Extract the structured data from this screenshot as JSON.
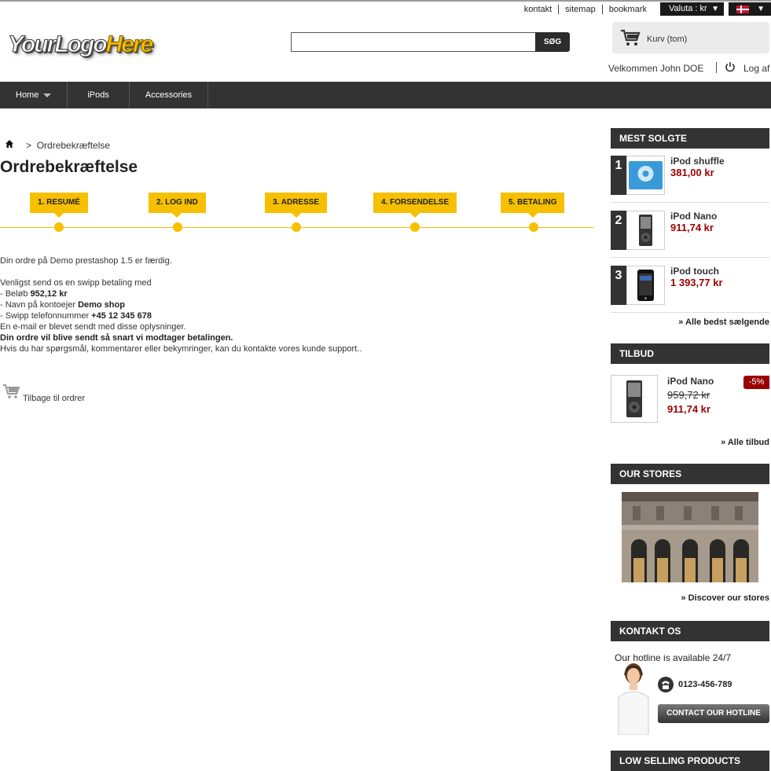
{
  "header": {
    "top_links": [
      "kontakt",
      "sitemap",
      "bookmark"
    ],
    "currency_label": "Valuta : kr",
    "currency_arrow": "▼",
    "language_arrow": "▼",
    "logo_part1": "YourLogo",
    "logo_part2": "Here",
    "search_placeholder": "",
    "search_button": "SØG",
    "cart_label": "Kurv (tom)",
    "welcome": "Velkommen John DOE",
    "logout": "Log af"
  },
  "nav": {
    "items": [
      "Home",
      "iPods",
      "Accessories"
    ]
  },
  "breadcrumb": {
    "separator": ">",
    "current": "Ordrebekræftelse"
  },
  "page": {
    "title": "Ordrebekræftelse",
    "steps": [
      "1. RESUMÉ",
      "2. LOG IND",
      "3. ADRESSE",
      "4. FORSENDELSE",
      "5. BETALING"
    ],
    "confirmation": {
      "line1": "Din ordre på Demo prestashop 1.5 er færdig.",
      "line2": "Venligst send os en swipp betaling med",
      "amount_prefix": "- Beløb ",
      "amount": "952,12 kr",
      "owner_prefix": "- Navn på kontoejer ",
      "owner": "Demo shop",
      "phone_prefix": "- Swipp telefonnummer ",
      "phone": "+45 12 345 678",
      "email_note": "En e-mail er blevet sendt med disse oplysninger.",
      "shipping_note": "Din ordre vil blive sendt så snart vi modtager betalingen.",
      "support_note": "Hvis du har spørgsmål, kommentarer eller bekymringer, kan du kontakte vores kunde support.."
    },
    "back_link": "Tilbage til ordrer"
  },
  "sidebar": {
    "bestsellers": {
      "title": "MEST SOLGTE",
      "items": [
        {
          "rank": "1",
          "name": "iPod shuffle",
          "price": "381,00 kr"
        },
        {
          "rank": "2",
          "name": "iPod Nano",
          "price": "911,74 kr"
        },
        {
          "rank": "3",
          "name": "iPod touch",
          "price": "1 393,77 kr"
        }
      ],
      "more": "» Alle bedst sælgende"
    },
    "specials": {
      "title": "TILBUD",
      "name": "iPod Nano",
      "old_price": "959,72 kr",
      "new_price": "911,74 kr",
      "discount": "-5%",
      "more": "» Alle tilbud"
    },
    "stores": {
      "title": "OUR STORES",
      "more": "» Discover our stores"
    },
    "contact": {
      "title": "KONTAKT OS",
      "hotline_text": "Our hotline is available 24/7",
      "phone": "0123-456-789",
      "button": "CONTACT OUR HOTLINE"
    },
    "low_selling": {
      "title": "LOW SELLING PRODUCTS"
    }
  },
  "colors": {
    "accent": "#f6c000",
    "dark": "#333333",
    "price": "#990000"
  }
}
